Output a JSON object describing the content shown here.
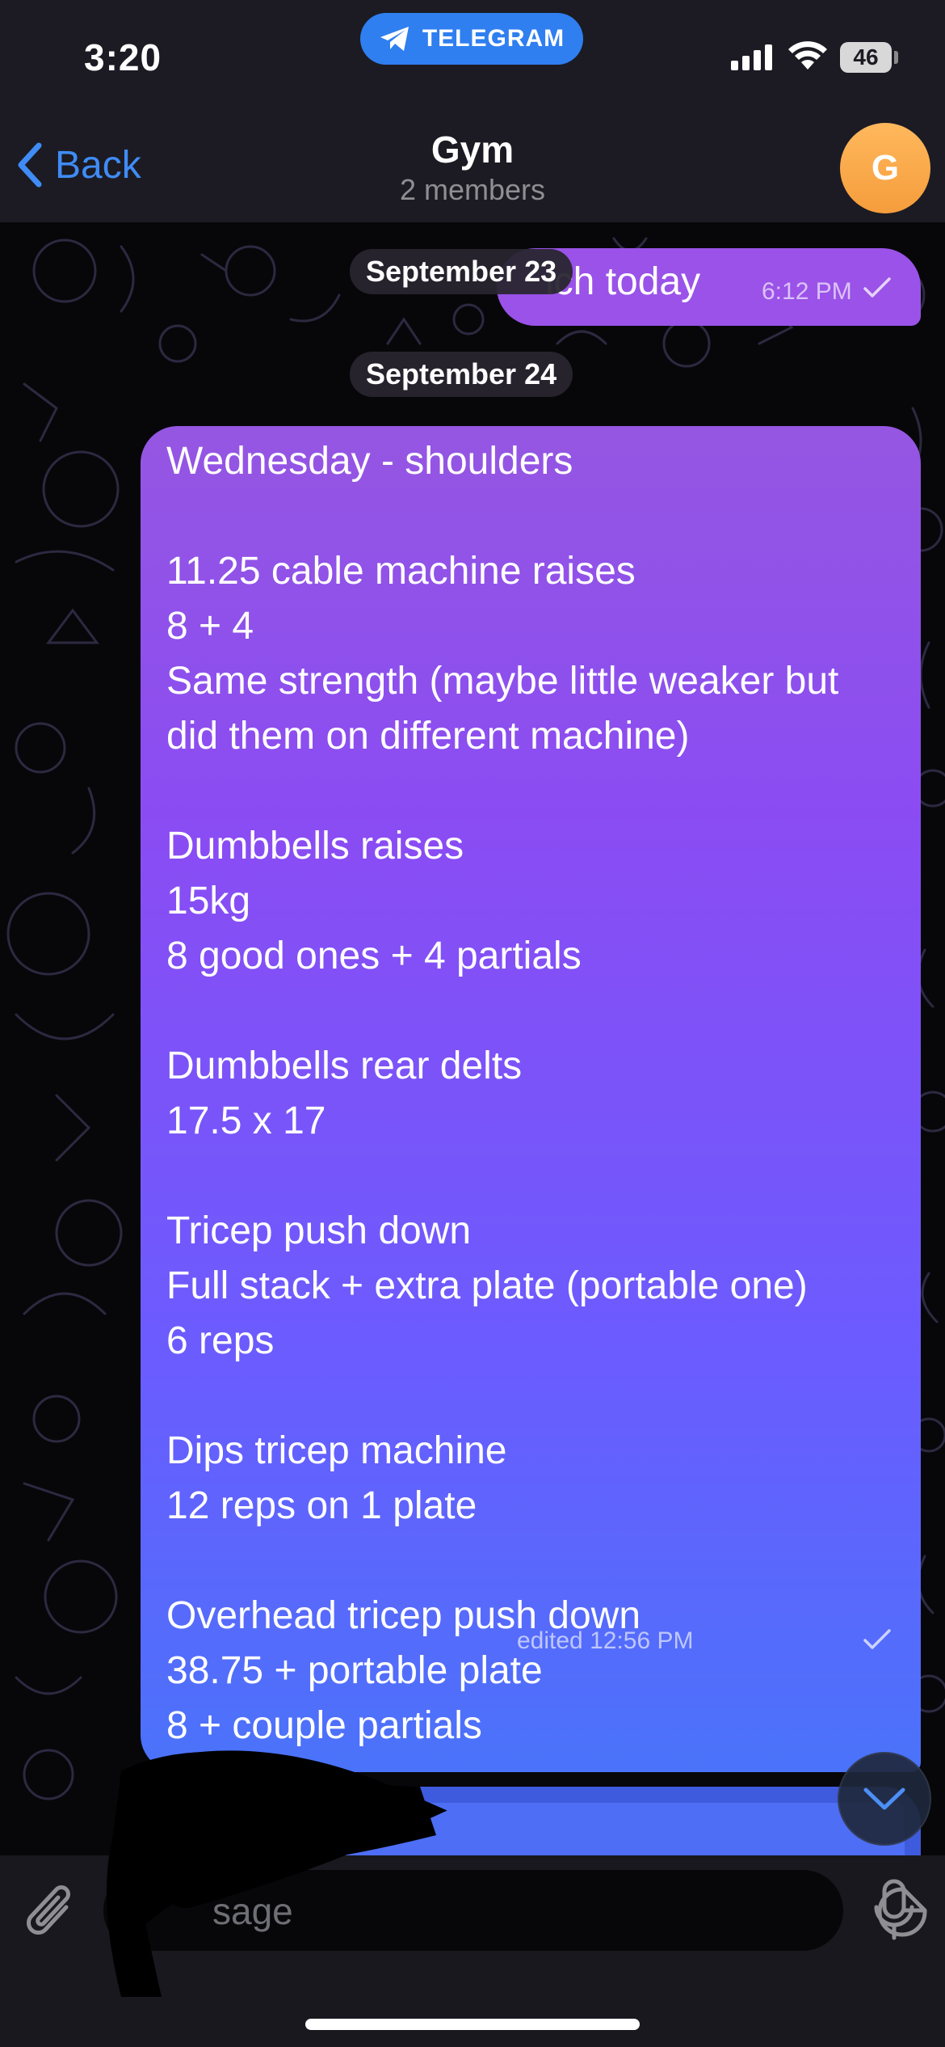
{
  "status_bar": {
    "time": "3:20",
    "app_pill": "TELEGRAM",
    "battery": "46"
  },
  "header": {
    "back_label": "Back",
    "title": "Gym",
    "subtitle": "2 members",
    "avatar_initial": "G"
  },
  "chat": {
    "previous_message": {
      "text": "ich today",
      "time": "6:12 PM"
    },
    "date_chips": [
      "September 23",
      "September 24"
    ],
    "message": {
      "lines": [
        "Wednesday - shoulders",
        "",
        "11.25 cable machine raises",
        "8 + 4",
        "Same strength (maybe little weaker but",
        "did them on different machine)",
        "",
        "Dumbbells raises",
        "15kg",
        "8 good ones + 4 partials",
        "",
        "Dumbbells rear delts",
        "17.5 x 17",
        "",
        "Tricep push down",
        "Full stack + extra plate (portable one)",
        "6 reps",
        "",
        "Dips tricep machine",
        "12 reps on 1 plate",
        "",
        "Overhead tricep push down",
        "38.75 + portable plate",
        "8 + couple partials"
      ],
      "meta": "edited 12:56 PM"
    }
  },
  "input": {
    "placeholder_visible": "sage"
  },
  "colors": {
    "accent": "#3f8cf6",
    "avatar": "#f8a84b",
    "bubble_top": "#9556e2",
    "bubble_bottom": "#4a73fa"
  }
}
